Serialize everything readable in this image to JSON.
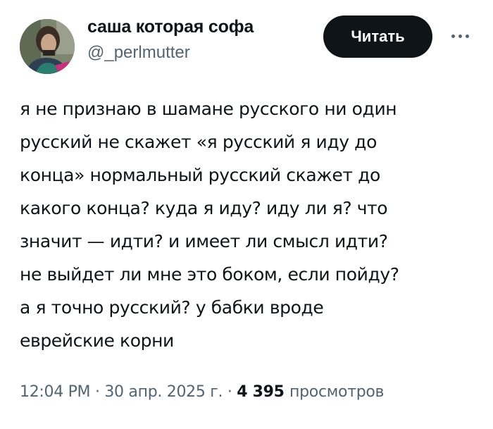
{
  "author": {
    "display_name": "саша которая софа",
    "handle": "@_perlmutter"
  },
  "actions": {
    "follow_label": "Читать",
    "more_icon": "more-horizontal-icon"
  },
  "tweet": {
    "lines": [
      "я не признаю в шамане русского ни один",
      "русский не скажет «я русский я иду до",
      "конца» нормальный русский скажет до",
      "какого конца? куда я иду? иду ли я? что",
      "значит — идти? и имеет ли смысл идти?",
      "не выйдет ли мне это боком, если пойду?",
      "а я точно русский? у бабки вроде",
      "еврейские корни"
    ]
  },
  "meta": {
    "time": "12:04 PM",
    "separator": "·",
    "date": "30 апр. 2025 г.",
    "views_count": "4 395",
    "views_label": "просмотров"
  },
  "colors": {
    "text_primary": "#0f1419",
    "text_secondary": "#536471",
    "button_bg": "#0f1419",
    "button_text": "#ffffff"
  }
}
